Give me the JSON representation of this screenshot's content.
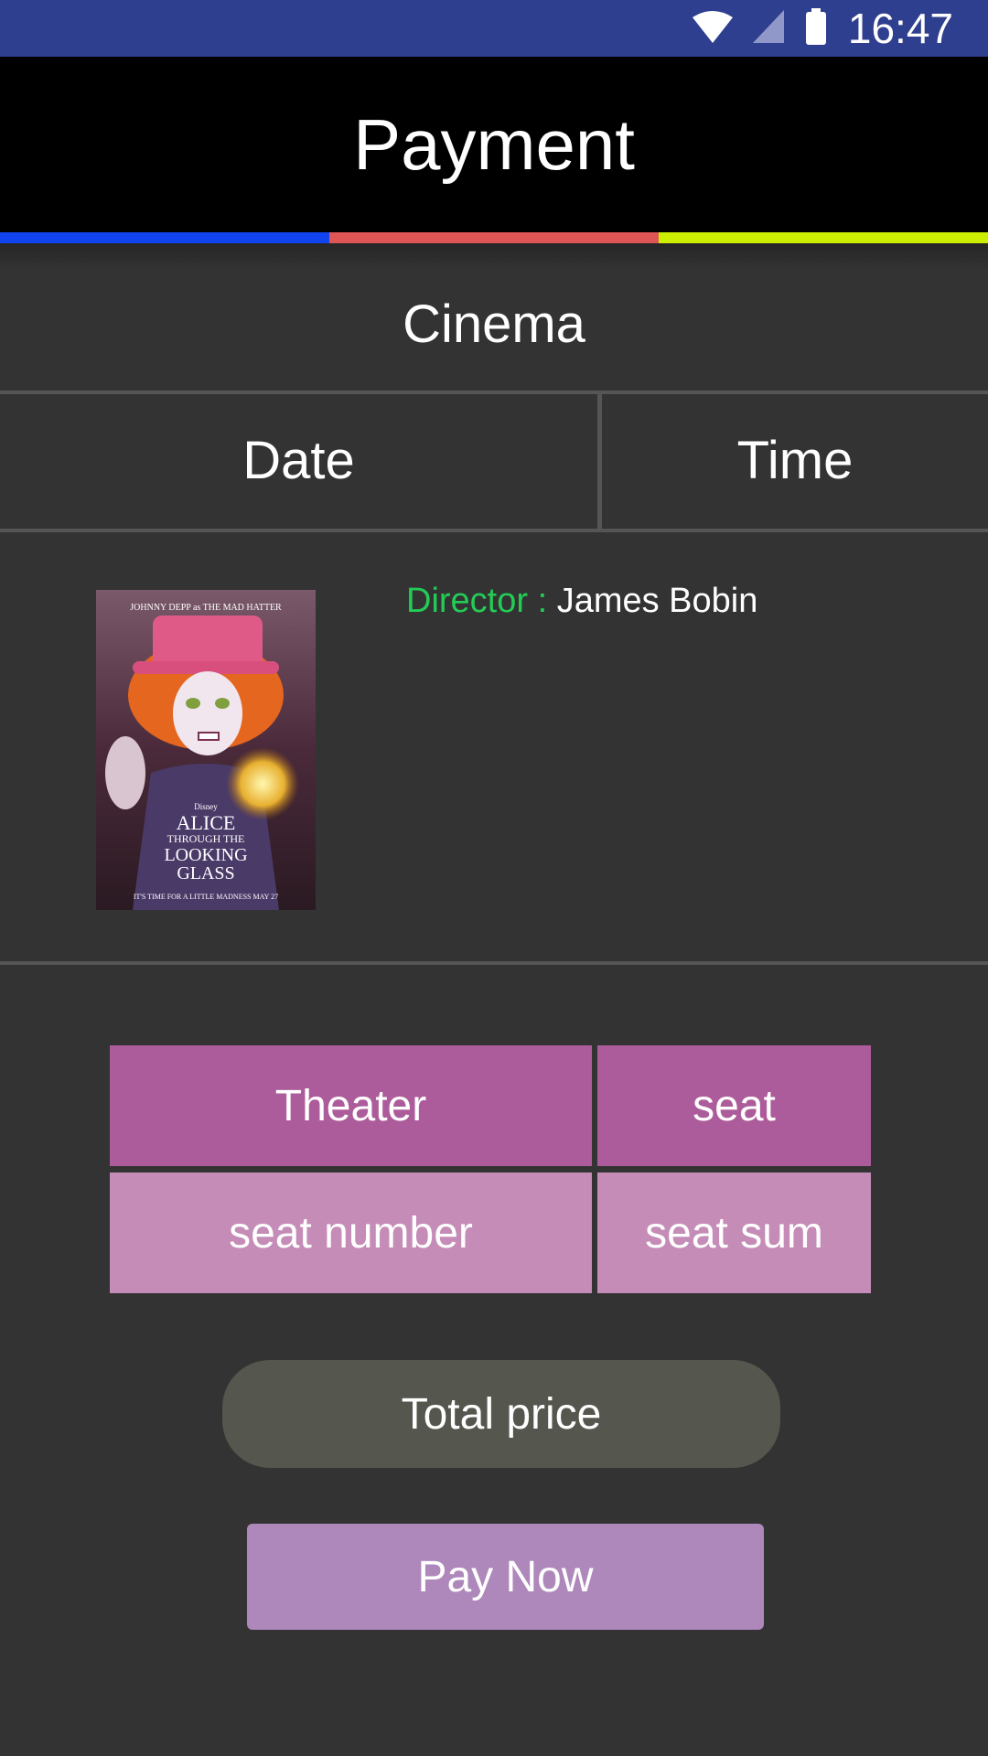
{
  "status_bar": {
    "time": "16:47",
    "icons": [
      "wifi-icon",
      "signal-icon",
      "battery-icon"
    ]
  },
  "app_bar": {
    "title": "Payment"
  },
  "accent_colors": [
    "#1144ee",
    "#dd5555",
    "#ccee00"
  ],
  "cinema": {
    "label": "Cinema"
  },
  "schedule": {
    "date_label": "Date",
    "time_label": "Time"
  },
  "movie": {
    "poster": {
      "top_text": "JOHNNY DEPP as THE MAD HATTER",
      "brand": "Disney",
      "title_lines": [
        "ALICE",
        "THROUGH THE",
        "LOOKING",
        "GLASS"
      ],
      "tagline": "IT'S TIME FOR A LITTLE MADNESS MAY 27"
    },
    "director_label": "Director : ",
    "director_name": "James Bobin"
  },
  "ticket_grid": {
    "theater_label": "Theater",
    "seat_label": "seat",
    "seat_number_label": "seat number",
    "seat_sum_label": "seat sum",
    "header_color": "#ad5c9b",
    "row_color": "#c48cb7"
  },
  "total_price_label": "Total price",
  "pay_button_label": "Pay Now"
}
